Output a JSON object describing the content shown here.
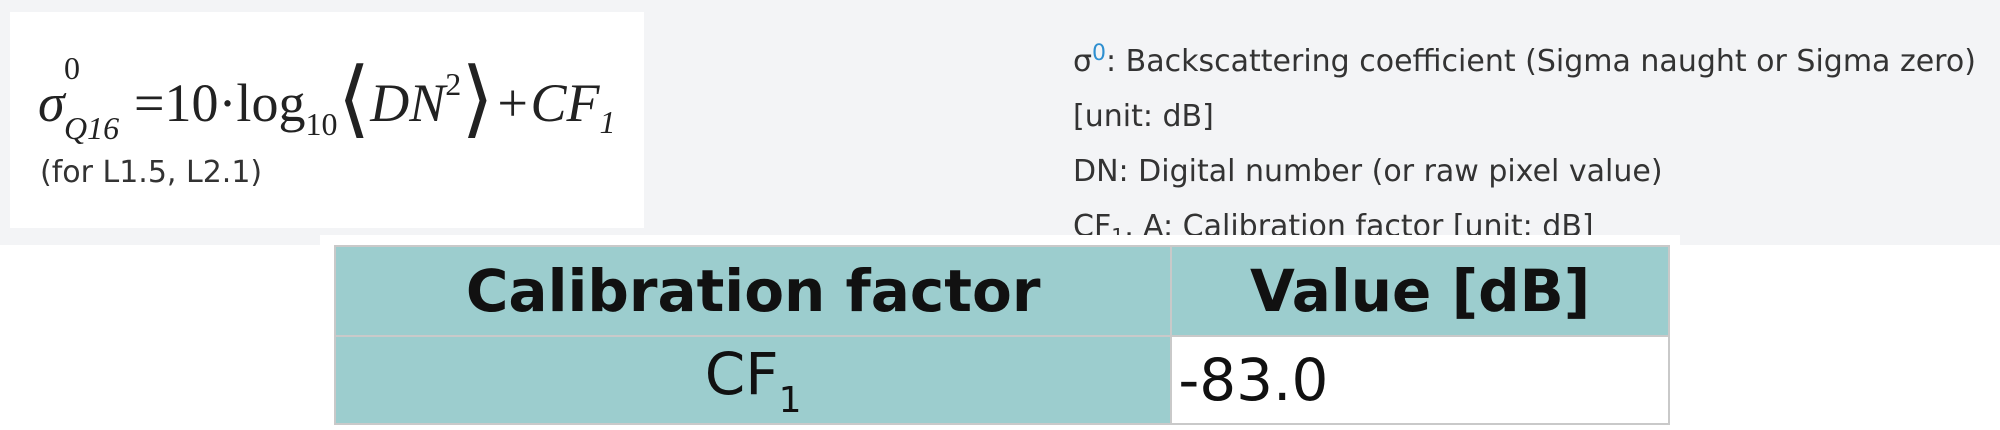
{
  "formula": {
    "sigma": "σ",
    "sigma_sup": "0",
    "sigma_sub": "Q16",
    "equals_ten": "=10·log",
    "log_base": "10",
    "open_angle": "⟨",
    "dn": "DN",
    "dn_exp": "2",
    "close_angle": "⟩",
    "plus_cf": "+CF",
    "cf_sub": "1",
    "note": "(for L1.5, L2.1)"
  },
  "legend": {
    "line1_symbol": "σ",
    "line1_sup": "0",
    "line1_text": ": Backscattering coefficient (Sigma naught or Sigma zero)",
    "line2": "[unit: dB]",
    "line3": "DN: Digital number (or raw pixel value)",
    "line4_prefix": "CF",
    "line4_sub": "1",
    "line4_text": ", A: Calibration factor [unit: dB]"
  },
  "table": {
    "headers": [
      "Calibration factor",
      "Value [dB]"
    ],
    "rows": [
      {
        "factor": "CF",
        "factor_sub": "1",
        "value": "-83.0"
      }
    ]
  },
  "colors": {
    "table_header_bg": "#9ccdce",
    "legend_superscript": "#2e8fd0"
  }
}
